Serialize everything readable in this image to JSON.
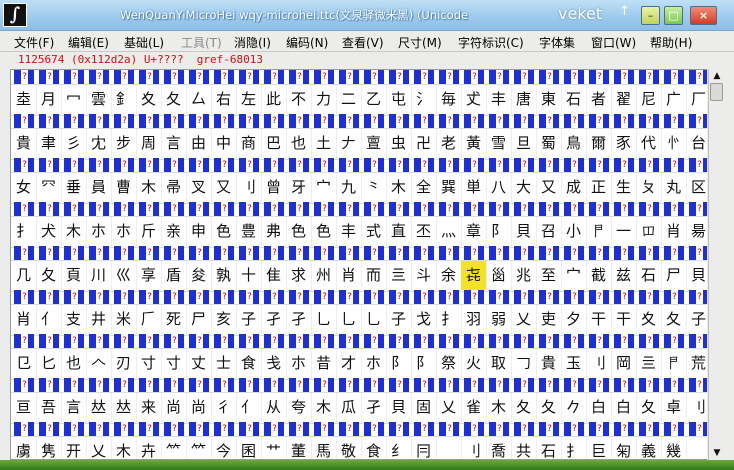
{
  "window": {
    "title": "WenQuanYiMicroHei  wqy-microhei.ttc(文泉驿微米黑) (Unicode",
    "wm_name": "veket",
    "wm_arrow": "↑",
    "min_symbol": "–",
    "max_symbol": "□",
    "close_symbol": "×",
    "app_glyph": "∫"
  },
  "menu": [
    {
      "label": "文件(F)",
      "enabled": true
    },
    {
      "label": "编辑(E)",
      "enabled": true
    },
    {
      "label": "基础(L)",
      "enabled": true
    },
    {
      "label": "工具(T)",
      "enabled": false
    },
    {
      "label": "消隐(I)",
      "enabled": true
    },
    {
      "label": "编码(N)",
      "enabled": true
    },
    {
      "label": "查看(V)",
      "enabled": true
    },
    {
      "label": "尺寸(M)",
      "enabled": true
    },
    {
      "label": "字符标识(C)",
      "enabled": true
    },
    {
      "label": "字体集",
      "enabled": true
    },
    {
      "label": "窗口(W)",
      "enabled": true
    },
    {
      "label": "帮助(H)",
      "enabled": true
    }
  ],
  "status": "1125674 (0x112d2a) U+????  gref-68013",
  "placeholder_glyph": "?",
  "selected": {
    "row": 4,
    "col": 18
  },
  "glyph_rows": [
    "坴月冖雲釒夊夂厶右左此不力二乙屯氵毎𠀋丰唐東石者翟尼广厂",
    "貴聿彡冘步周言由中商巴也土𠂇亶虫卍老黃雪旦蜀鳥爾豕代㣺台",
    "女㓁垂員曹木帚叉又刂曾牙宀九⺀木全巽単八大又成正生ㄆ丸区",
    "扌犬木朩朩斤亲申色豊弗色色丰式直丕灬章阝貝召小𠁣一𫩏肖昜",
    "几夂頁川巛享盾夋孰十隹求州肖而亖斗余㐂𡿺兆至宀截兹石尸貝",
    "肖亻支井米𠂆死尸亥子孑孑乚乚乚子戈扌羽弱乂吏夕干干夊夂子",
    "㔾匕也𠆢刃寸寸丈士食戋朩昔才朩阝阝祭火取𠃌貴玉刂岡亖𠁣荒",
    "亘吾言𠀤𠀤来尚尚彳亻从夸木瓜孑貝固乂雀木夂夂𠂊白白夂卓刂",
    "虜隽开乂木卉𥫗𥫗今囷艹董馬敬食纟冃𤕤刂喬共石扌巨匊義幾"
  ],
  "scroll": {
    "up_symbol": "▲",
    "down_symbol": "▼",
    "thumb_start": 0.0,
    "thumb_fraction": 0.05
  }
}
